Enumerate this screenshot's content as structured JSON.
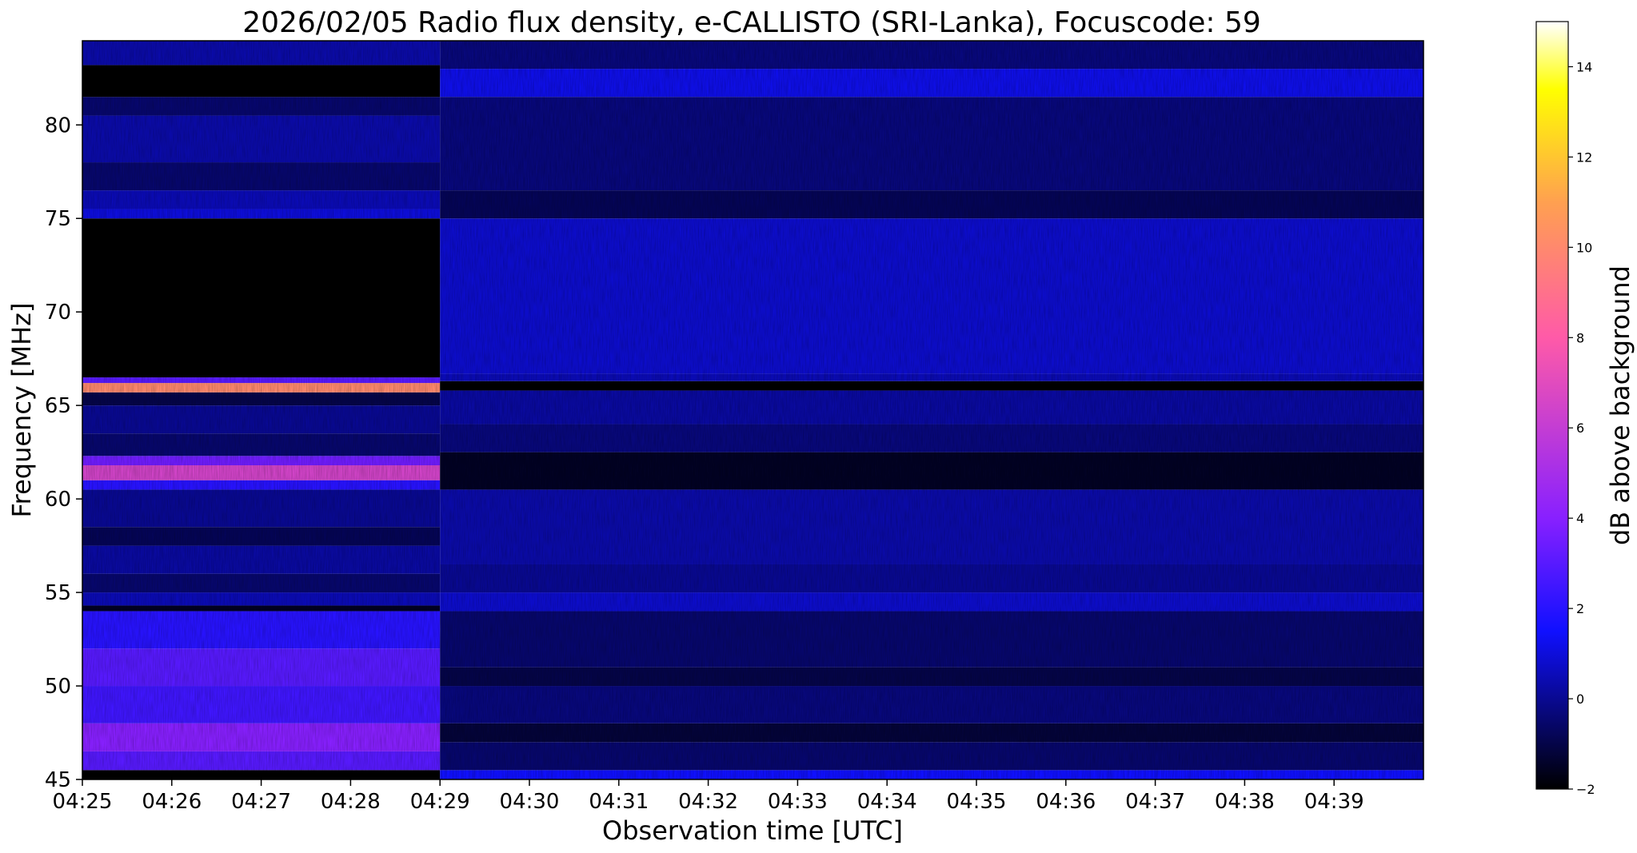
{
  "chart_data": {
    "type": "heatmap",
    "title": "2026/02/05  Radio flux density, e-CALLISTO (SRI-Lanka), Focuscode: 59",
    "xlabel": "Observation time [UTC]",
    "ylabel": "Frequency [MHz]",
    "x_ticks": [
      "04:25",
      "04:26",
      "04:27",
      "04:28",
      "04:29",
      "04:30",
      "04:31",
      "04:32",
      "04:33",
      "04:34",
      "04:35",
      "04:36",
      "04:37",
      "04:38",
      "04:39"
    ],
    "xlim": [
      "04:25:00",
      "04:40:00"
    ],
    "y_ticks": [
      45,
      50,
      55,
      60,
      65,
      70,
      75,
      80
    ],
    "ylim": [
      45,
      84.5
    ],
    "colorbar": {
      "label": "dB above background",
      "ticks": [
        -2,
        0,
        2,
        4,
        6,
        8,
        10,
        12,
        14
      ],
      "range": [
        -2,
        15
      ],
      "colormap_stops": [
        {
          "value": -2,
          "color": "#000000"
        },
        {
          "value": 1.5,
          "color": "#1010ff"
        },
        {
          "value": 4,
          "color": "#8820ff"
        },
        {
          "value": 8,
          "color": "#ff5aa8"
        },
        {
          "value": 11,
          "color": "#ffa050"
        },
        {
          "value": 13.5,
          "color": "#ffff00"
        },
        {
          "value": 15,
          "color": "#ffffff"
        }
      ]
    },
    "segments": [
      {
        "time_range": [
          "04:25:00",
          "04:29:00"
        ],
        "bands": [
          {
            "f_lo": 45.0,
            "f_hi": 45.5,
            "db": -2.0
          },
          {
            "f_lo": 45.5,
            "f_hi": 46.5,
            "db": 3.0
          },
          {
            "f_lo": 46.5,
            "f_hi": 48.0,
            "db": 4.0
          },
          {
            "f_lo": 48.0,
            "f_hi": 50.0,
            "db": 2.5
          },
          {
            "f_lo": 50.0,
            "f_hi": 52.0,
            "db": 3.0
          },
          {
            "f_lo": 52.0,
            "f_hi": 54.0,
            "db": 2.0
          },
          {
            "f_lo": 54.0,
            "f_hi": 54.3,
            "db": -1.5
          },
          {
            "f_lo": 54.3,
            "f_hi": 55.0,
            "db": 0.5
          },
          {
            "f_lo": 55.0,
            "f_hi": 56.0,
            "db": -0.5
          },
          {
            "f_lo": 56.0,
            "f_hi": 57.5,
            "db": 0.2
          },
          {
            "f_lo": 57.5,
            "f_hi": 58.5,
            "db": -0.8
          },
          {
            "f_lo": 58.5,
            "f_hi": 60.5,
            "db": 0.0
          },
          {
            "f_lo": 60.5,
            "f_hi": 61.0,
            "db": 2.0
          },
          {
            "f_lo": 61.0,
            "f_hi": 61.8,
            "db": 6.5
          },
          {
            "f_lo": 61.8,
            "f_hi": 62.3,
            "db": 3.5
          },
          {
            "f_lo": 62.3,
            "f_hi": 63.5,
            "db": -0.5
          },
          {
            "f_lo": 63.5,
            "f_hi": 65.0,
            "db": 0.0
          },
          {
            "f_lo": 65.0,
            "f_hi": 65.7,
            "db": -1.0
          },
          {
            "f_lo": 65.7,
            "f_hi": 66.2,
            "db": 10.0
          },
          {
            "f_lo": 66.2,
            "f_hi": 66.5,
            "db": 3.0
          },
          {
            "f_lo": 66.5,
            "f_hi": 75.0,
            "db": -2.0
          },
          {
            "f_lo": 75.0,
            "f_hi": 75.5,
            "db": 1.0
          },
          {
            "f_lo": 75.5,
            "f_hi": 76.5,
            "db": 0.5
          },
          {
            "f_lo": 76.5,
            "f_hi": 78.0,
            "db": -0.5
          },
          {
            "f_lo": 78.0,
            "f_hi": 80.5,
            "db": 0.3
          },
          {
            "f_lo": 80.5,
            "f_hi": 81.5,
            "db": -0.5
          },
          {
            "f_lo": 81.5,
            "f_hi": 83.2,
            "db": -2.0
          },
          {
            "f_lo": 83.2,
            "f_hi": 84.5,
            "db": 0.3
          }
        ]
      },
      {
        "time_range": [
          "04:29:00",
          "04:40:00"
        ],
        "bands": [
          {
            "f_lo": 45.0,
            "f_hi": 45.5,
            "db": 1.5
          },
          {
            "f_lo": 45.5,
            "f_hi": 47.0,
            "db": -0.5
          },
          {
            "f_lo": 47.0,
            "f_hi": 48.0,
            "db": -1.2
          },
          {
            "f_lo": 48.0,
            "f_hi": 50.0,
            "db": -0.3
          },
          {
            "f_lo": 50.0,
            "f_hi": 51.0,
            "db": -1.0
          },
          {
            "f_lo": 51.0,
            "f_hi": 54.0,
            "db": -0.5
          },
          {
            "f_lo": 54.0,
            "f_hi": 55.0,
            "db": 0.8
          },
          {
            "f_lo": 55.0,
            "f_hi": 56.5,
            "db": 0.0
          },
          {
            "f_lo": 56.5,
            "f_hi": 60.5,
            "db": 0.3
          },
          {
            "f_lo": 60.5,
            "f_hi": 62.5,
            "db": -1.5
          },
          {
            "f_lo": 62.5,
            "f_hi": 64.0,
            "db": -0.3
          },
          {
            "f_lo": 64.0,
            "f_hi": 65.8,
            "db": 0.2
          },
          {
            "f_lo": 65.8,
            "f_hi": 66.3,
            "db": -2.0
          },
          {
            "f_lo": 66.3,
            "f_hi": 66.7,
            "db": 0.5
          },
          {
            "f_lo": 66.7,
            "f_hi": 75.0,
            "db": 0.8
          },
          {
            "f_lo": 75.0,
            "f_hi": 76.5,
            "db": -0.8
          },
          {
            "f_lo": 76.5,
            "f_hi": 81.5,
            "db": -0.3
          },
          {
            "f_lo": 81.5,
            "f_hi": 83.0,
            "db": 1.2
          },
          {
            "f_lo": 83.0,
            "f_hi": 84.5,
            "db": -0.3
          }
        ]
      }
    ],
    "grid": false,
    "legend": "colorbar-right"
  }
}
